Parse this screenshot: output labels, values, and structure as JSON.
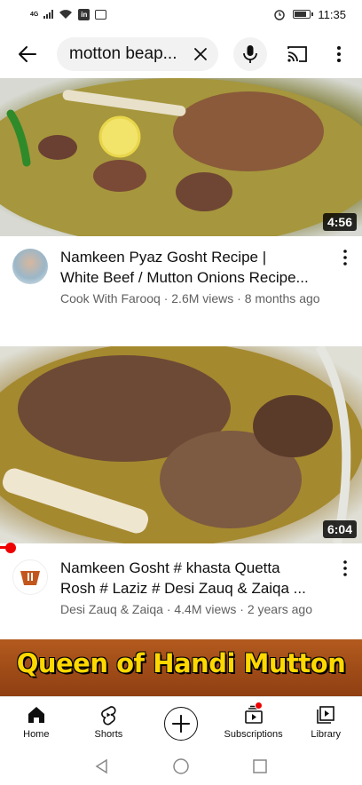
{
  "status_bar": {
    "network_label": "4G",
    "time": "11:35",
    "linkedin_icon_text": "in"
  },
  "search": {
    "query": "motton beap..."
  },
  "videos": [
    {
      "duration": "4:56",
      "title_line1": "Namkeen Pyaz Gosht Recipe |",
      "title_line2": "White Beef / Mutton Onions Recipe...",
      "meta": "Cook With Farooq · 2.6M views · 8 months ago"
    },
    {
      "duration": "6:04",
      "watch_progress": 0.03,
      "title_line1": "Namkeen Gosht # khasta Quetta",
      "title_line2": "Rosh # Laziz # Desi Zauq & Zaiqa ...",
      "meta": "Desi Zauq & Zaiqa · 4.4M views · 2 years ago"
    },
    {
      "banner_text": "Queen of Handi Mutton"
    }
  ],
  "bottom_nav": {
    "home": "Home",
    "shorts": "Shorts",
    "subscriptions": "Subscriptions",
    "library": "Library"
  },
  "colors": {
    "accent_red": "#ff0000",
    "banner_yellow": "#ffd800"
  }
}
